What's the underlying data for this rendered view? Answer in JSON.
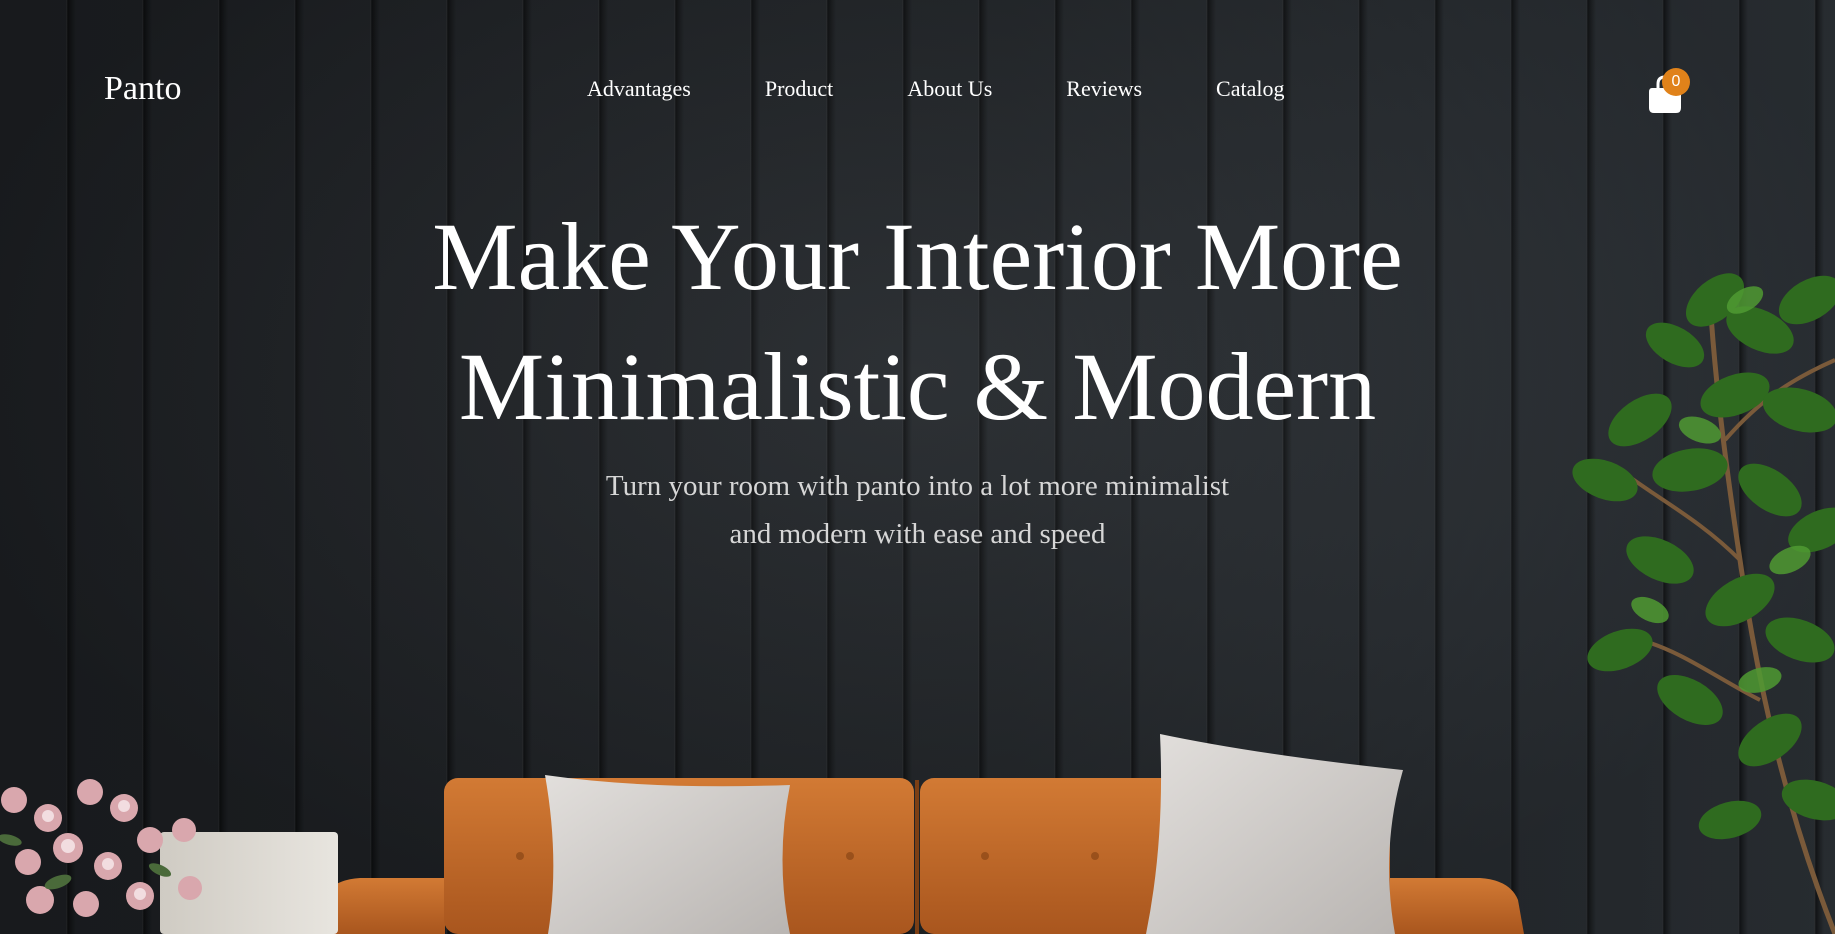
{
  "header": {
    "brand": "Panto",
    "nav": [
      {
        "label": "Advantages"
      },
      {
        "label": "Product"
      },
      {
        "label": "About Us"
      },
      {
        "label": "Reviews"
      },
      {
        "label": "Catalog"
      }
    ],
    "cart": {
      "icon": "shopping-bag-icon",
      "count": "0",
      "badge_color": "#e0821a"
    }
  },
  "hero": {
    "headline": [
      "Make Your Interior More",
      "Minimalistic & Modern"
    ],
    "subtitle": [
      "Turn your room with panto into a lot more minimalist",
      "and modern with ease and speed"
    ]
  },
  "colors": {
    "background": "#25292d",
    "text": "#ffffff",
    "subtitle_text": "#d6d6d6",
    "sofa": "#c8702c",
    "accent": "#e0821a"
  }
}
